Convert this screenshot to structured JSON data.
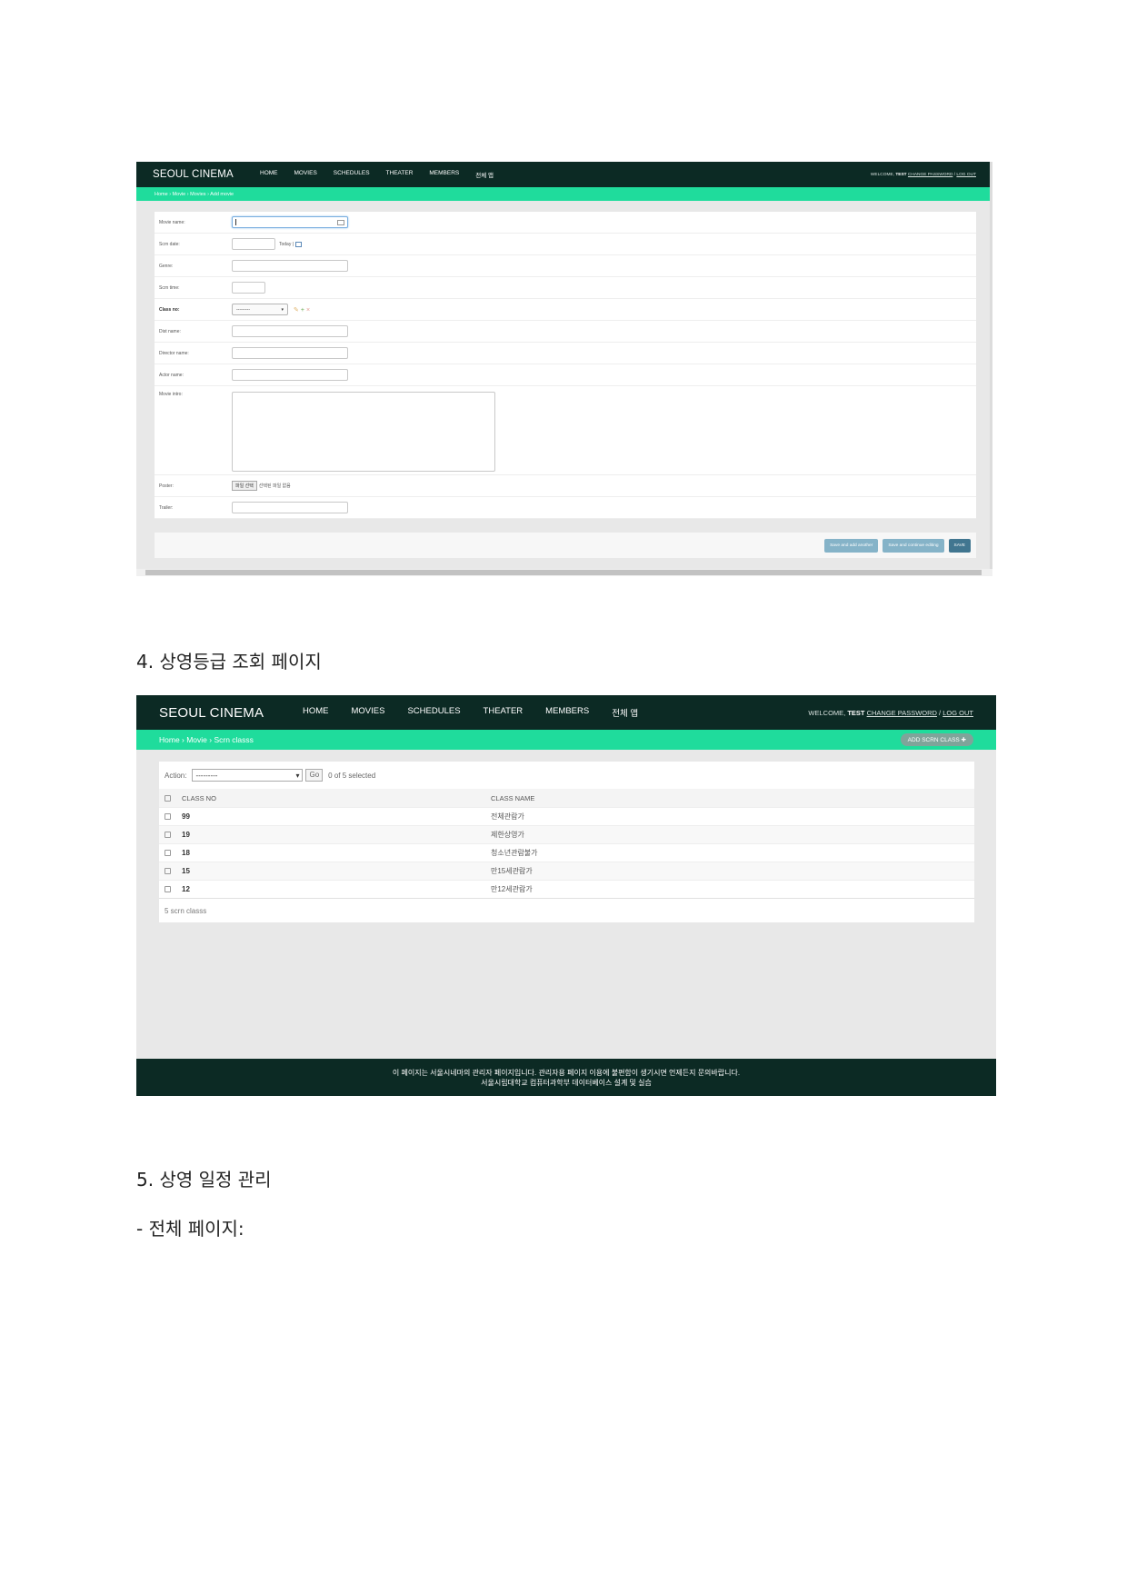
{
  "shot1": {
    "brand": "SEOUL CINEMA",
    "nav": [
      "HOME",
      "MOVIES",
      "SCHEDULES",
      "THEATER",
      "MEMBERS",
      "전체 앱"
    ],
    "user": {
      "welcome": "WELCOME, ",
      "name": "TEST",
      "change_password": "CHANGE PASSWORD",
      "sep": " / ",
      "logout": "LOG OUT"
    },
    "breadcrumb": "Home › Movie › Movies › Add movie",
    "fields": {
      "movie_name": "Movie name:",
      "scrn_date": "Scrn date:",
      "today": "Today |",
      "genre": "Genre:",
      "scrn_time": "Scrn time:",
      "class_no": "Class no:",
      "class_select": "---------",
      "dist_name": "Dist name:",
      "director_name": "Director name:",
      "actor_name": "Actor name:",
      "movie_intro": "Movie intro:",
      "poster": "Poster:",
      "file_button": "파일 선택",
      "file_none": "선택된 파일 없음",
      "trailer": "Trailer:"
    },
    "buttons": {
      "save_add": "Save and add another",
      "save_continue": "Save and continue editing",
      "save": "SAVE"
    }
  },
  "heading4": "4. 상영등급 조회 페이지",
  "shot2": {
    "brand": "SEOUL CINEMA",
    "nav": [
      "HOME",
      "MOVIES",
      "SCHEDULES",
      "THEATER",
      "MEMBERS",
      "전체 앱"
    ],
    "user": {
      "welcome": "WELCOME, ",
      "name": "TEST",
      "change_password": "CHANGE PASSWORD",
      "sep": " / ",
      "logout": "LOG OUT"
    },
    "breadcrumb": "Home › Movie › Scrn classs",
    "add_button": "ADD SCRN CLASS ✚",
    "action_label": "Action:",
    "action_select": "---------",
    "go": "Go",
    "selected": "0 of 5 selected",
    "columns": [
      "CLASS NO",
      "CLASS NAME"
    ],
    "rows": [
      {
        "no": "99",
        "name": "전체관람가"
      },
      {
        "no": "19",
        "name": "제한상영가"
      },
      {
        "no": "18",
        "name": "청소년관람불가"
      },
      {
        "no": "15",
        "name": "만15세관람가"
      },
      {
        "no": "12",
        "name": "만12세관람가"
      }
    ],
    "count": "5 scrn classs",
    "footer_line1": "이 페이지는 서울시네마의 관리자 페이지입니다. 관리자용 페이지 이용에 불편함이 생기시면 언제든지 문의바랍니다.",
    "footer_line2": "서울시립대학교 컴퓨터과학부 데이터베이스 설계 및 실습"
  },
  "heading5": "5. 상영 일정 관리",
  "bullet": "- 전체 페이지:"
}
